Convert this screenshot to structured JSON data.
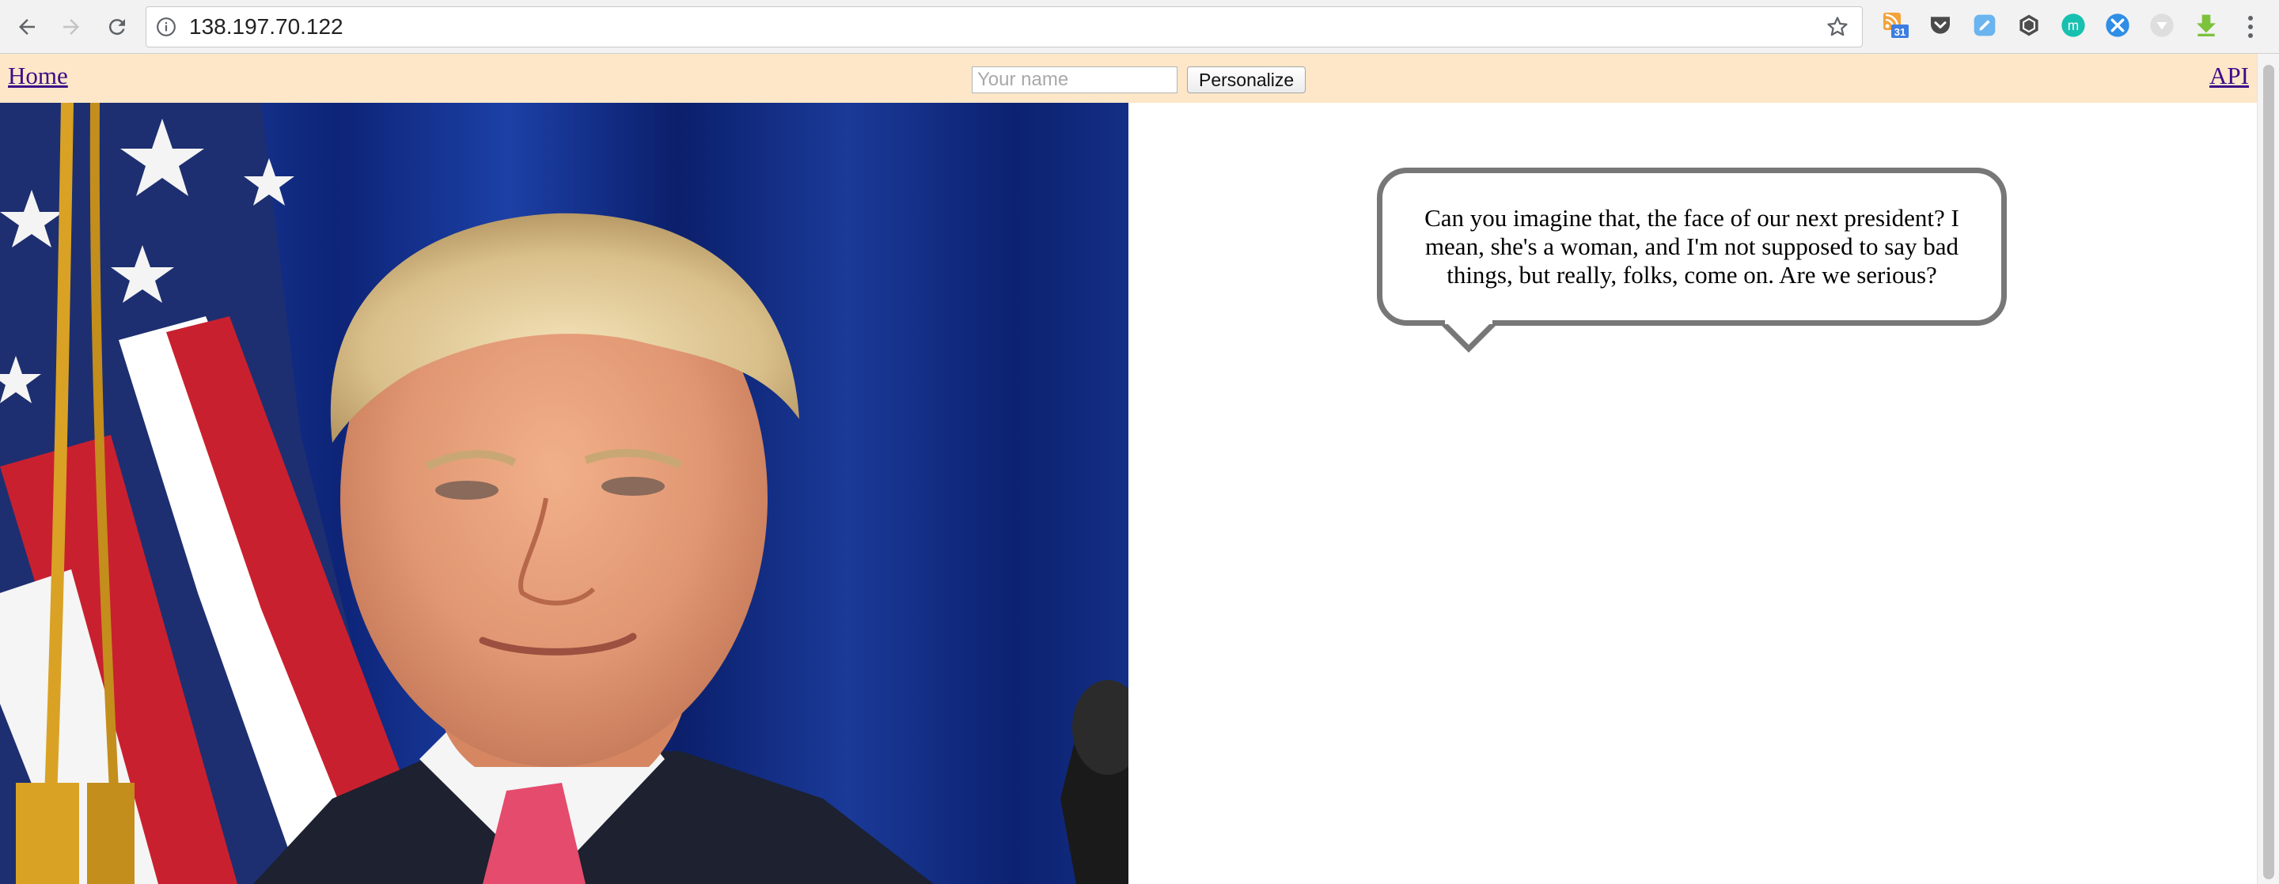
{
  "browser": {
    "url": "138.197.70.122"
  },
  "header": {
    "home_label": "Home",
    "name_placeholder": "Your name",
    "name_value": "",
    "personalize_label": "Personalize",
    "api_label": "API"
  },
  "bubble": {
    "text": "Can you imagine that, the face of our next president? I mean, she's a woman, and I'm not supposed to say bad things, but really, folks, come on. Are we serious?"
  },
  "extensions": {
    "calendar_badge": "31"
  },
  "colors": {
    "header_bg": "#fde7c8",
    "link": "#3b0d8a",
    "bubble_border": "#777777"
  }
}
